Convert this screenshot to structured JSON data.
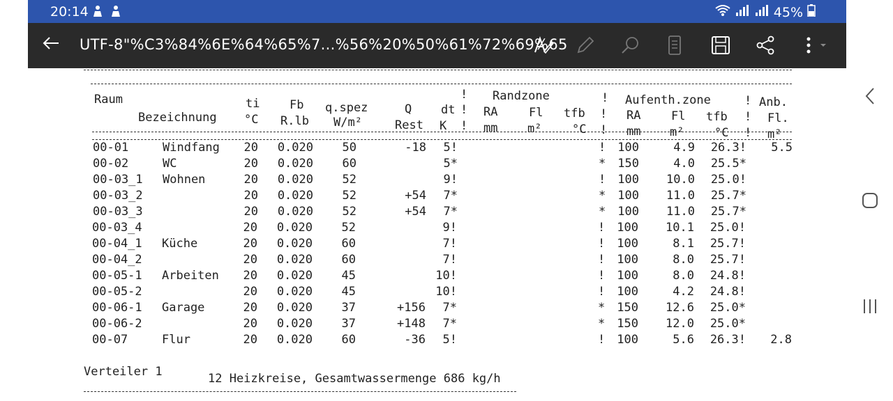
{
  "status_bar": {
    "time": "20:14",
    "battery": "45%"
  },
  "toolbar": {
    "title": "UTF-8\"%C3%84%6E%64%65%7...%56%20%50%61%72%69%65"
  },
  "document": {
    "header": {
      "raum": "Raum",
      "bezeichnung": "Bezeichnung",
      "ti": "ti",
      "ti_unit": "°C",
      "fb": "Fb",
      "fb_unit": "R.lb",
      "qspez": "q.spez",
      "qspez_unit": "W/m²",
      "q": "Q",
      "q_unit": "Rest",
      "dt": "dt",
      "dt_unit": "K",
      "randzone": "Randzone",
      "ra": "RA",
      "ra_unit": "mm",
      "fl": "Fl",
      "fl_unit": "m²",
      "tfb": "tfb",
      "tfb_unit": "°C",
      "aufenth": "Aufenth.zone",
      "anb": "Anb.",
      "anb_fl": "Fl.",
      "anb_unit": "m²",
      "bang": "!"
    },
    "rows": [
      {
        "raum": "00-01",
        "bez": "Windfang",
        "ti": "20",
        "fb": "0.020",
        "q": "50",
        "rest": "-18",
        "dt": "5!",
        "mark": "!",
        "ra": "100",
        "fl": "4.9",
        "tfb": "26.3!",
        "anb": "5.5"
      },
      {
        "raum": "00-02",
        "bez": "WC",
        "ti": "20",
        "fb": "0.020",
        "q": "60",
        "rest": "",
        "dt": "5*",
        "mark": "*",
        "ra": "150",
        "fl": "4.0",
        "tfb": "25.5*",
        "anb": ""
      },
      {
        "raum": "00-03_1",
        "bez": "Wohnen",
        "ti": "20",
        "fb": "0.020",
        "q": "52",
        "rest": "",
        "dt": "9!",
        "mark": "!",
        "ra": "100",
        "fl": "10.0",
        "tfb": "25.0!",
        "anb": ""
      },
      {
        "raum": "00-03_2",
        "bez": "",
        "ti": "20",
        "fb": "0.020",
        "q": "52",
        "rest": "+54",
        "dt": "7*",
        "mark": "*",
        "ra": "100",
        "fl": "11.0",
        "tfb": "25.7*",
        "anb": ""
      },
      {
        "raum": "00-03_3",
        "bez": "",
        "ti": "20",
        "fb": "0.020",
        "q": "52",
        "rest": "+54",
        "dt": "7*",
        "mark": "*",
        "ra": "100",
        "fl": "11.0",
        "tfb": "25.7*",
        "anb": ""
      },
      {
        "raum": "00-03_4",
        "bez": "",
        "ti": "20",
        "fb": "0.020",
        "q": "52",
        "rest": "",
        "dt": "9!",
        "mark": "!",
        "ra": "100",
        "fl": "10.1",
        "tfb": "25.0!",
        "anb": ""
      },
      {
        "raum": "00-04_1",
        "bez": "Küche",
        "ti": "20",
        "fb": "0.020",
        "q": "60",
        "rest": "",
        "dt": "7!",
        "mark": "!",
        "ra": "100",
        "fl": "8.1",
        "tfb": "25.7!",
        "anb": ""
      },
      {
        "raum": "00-04_2",
        "bez": "",
        "ti": "20",
        "fb": "0.020",
        "q": "60",
        "rest": "",
        "dt": "7!",
        "mark": "!",
        "ra": "100",
        "fl": "8.0",
        "tfb": "25.7!",
        "anb": ""
      },
      {
        "raum": "00-05-1",
        "bez": "Arbeiten",
        "ti": "20",
        "fb": "0.020",
        "q": "45",
        "rest": "",
        "dt": "10!",
        "mark": "!",
        "ra": "100",
        "fl": "8.0",
        "tfb": "24.8!",
        "anb": ""
      },
      {
        "raum": "00-05-2",
        "bez": "",
        "ti": "20",
        "fb": "0.020",
        "q": "45",
        "rest": "",
        "dt": "10!",
        "mark": "!",
        "ra": "100",
        "fl": "4.2",
        "tfb": "24.8!",
        "anb": ""
      },
      {
        "raum": "00-06-1",
        "bez": "Garage",
        "ti": "20",
        "fb": "0.020",
        "q": "37",
        "rest": "+156",
        "dt": "7*",
        "mark": "*",
        "ra": "150",
        "fl": "12.6",
        "tfb": "25.0*",
        "anb": ""
      },
      {
        "raum": "00-06-2",
        "bez": "",
        "ti": "20",
        "fb": "0.020",
        "q": "37",
        "rest": "+148",
        "dt": "7*",
        "mark": "*",
        "ra": "150",
        "fl": "12.0",
        "tfb": "25.0*",
        "anb": ""
      },
      {
        "raum": "00-07",
        "bez": "Flur",
        "ti": "20",
        "fb": "0.020",
        "q": "60",
        "rest": "-36",
        "dt": "5!",
        "mark": "!",
        "ra": "100",
        "fl": "5.6",
        "tfb": "26.3!",
        "anb": "2.8"
      }
    ],
    "footer": {
      "verteiler": "Verteiler 1",
      "summary": "12 Heizkreise, Gesamtwassermenge 686 kg/h"
    }
  },
  "icons": {
    "back": "arrow-left-icon",
    "read": "text-to-speech-icon",
    "edit": "pencil-icon",
    "search": "search-icon",
    "page": "page-view-icon",
    "save": "save-icon",
    "share": "share-icon",
    "more": "more-vert-icon"
  },
  "colors": {
    "status_bar": "#2d55ad",
    "toolbar": "#2a2a2a"
  }
}
